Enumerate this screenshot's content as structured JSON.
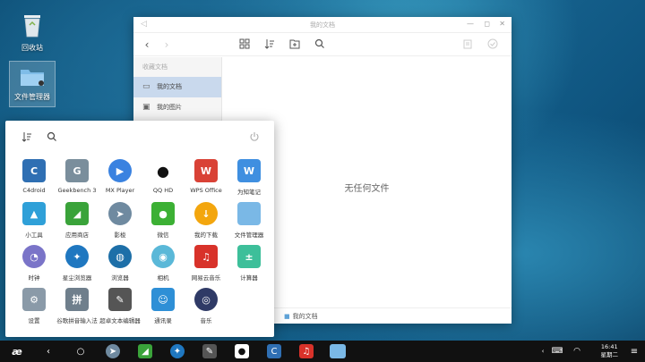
{
  "desktop": {
    "recycle_label": "回收站",
    "file_manager_label": "文件管理器"
  },
  "file_manager": {
    "title": "我的文档",
    "sidebar_heading": "收藏文档",
    "sidebar_items": [
      {
        "label": "我的文档",
        "icon": "folder-icon",
        "active": true
      },
      {
        "label": "我的图片",
        "icon": "image-icon",
        "active": false
      }
    ],
    "empty_text": "无任何文件",
    "breadcrumb": "我的文档"
  },
  "start_menu": {
    "apps": [
      {
        "label": "C4droid",
        "icon": "c4droid-icon",
        "color": "#2f6fb3"
      },
      {
        "label": "Geekbench 3",
        "icon": "geekbench-icon",
        "color": "#7a8e9c"
      },
      {
        "label": "MX Player",
        "icon": "play-icon",
        "color": "#3a82e0"
      },
      {
        "label": "QQ HD",
        "icon": "qq-icon",
        "color": "#ffffff"
      },
      {
        "label": "WPS Office",
        "icon": "wps-icon",
        "color": "#d94236"
      },
      {
        "label": "为知笔记",
        "icon": "wiz-note-icon",
        "color": "#3f8fe0"
      },
      {
        "label": "小工具",
        "icon": "tools-icon",
        "color": "#2fa0d8"
      },
      {
        "label": "应用商店",
        "icon": "app-store-icon",
        "color": "#3aa33a"
      },
      {
        "label": "影梭",
        "icon": "shadowsocks-icon",
        "color": "#6f8aa0"
      },
      {
        "label": "微信",
        "icon": "wechat-icon",
        "color": "#3cb034"
      },
      {
        "label": "我的下载",
        "icon": "download-icon",
        "color": "#f3a60e"
      },
      {
        "label": "文件管理器",
        "icon": "folder-icon",
        "color": "#7ab8e6"
      },
      {
        "label": "时钟",
        "icon": "clock-icon",
        "color": "#7a74c8"
      },
      {
        "label": "星尘浏览器",
        "icon": "stardust-browser-icon",
        "color": "#1f77c0"
      },
      {
        "label": "浏览器",
        "icon": "globe-icon",
        "color": "#1d6fa8"
      },
      {
        "label": "相机",
        "icon": "camera-icon",
        "color": "#5ab8d8"
      },
      {
        "label": "网易云音乐",
        "icon": "netease-music-icon",
        "color": "#d8322a"
      },
      {
        "label": "计算器",
        "icon": "calculator-icon",
        "color": "#3dbf9a"
      },
      {
        "label": "设置",
        "icon": "gear-icon",
        "color": "#8a9aa8"
      },
      {
        "label": "谷歌拼音输入法",
        "icon": "pinyin-icon",
        "color": "#6f7f8c"
      },
      {
        "label": "超卓文本编辑器",
        "icon": "text-editor-icon",
        "color": "#555555"
      },
      {
        "label": "通讯录",
        "icon": "contacts-icon",
        "color": "#2e8fd6"
      },
      {
        "label": "音乐",
        "icon": "music-icon",
        "color": "#2f3a66"
      }
    ]
  },
  "taskbar": {
    "time": "16:41",
    "weekday": "星期二"
  }
}
